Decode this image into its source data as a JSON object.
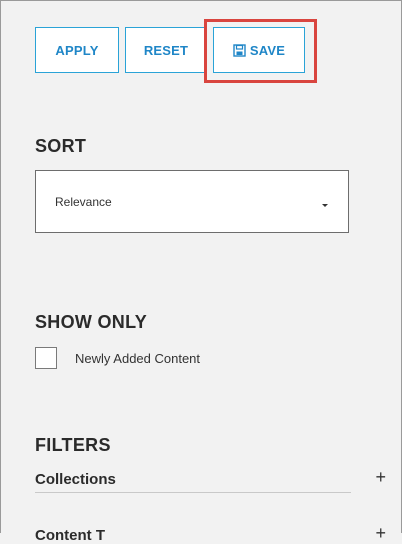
{
  "toolbar": {
    "apply_label": "APPLY",
    "reset_label": "RESET",
    "save_label": "SAVE"
  },
  "sort": {
    "title": "SORT",
    "selected": "Relevance"
  },
  "show_only": {
    "title": "SHOW ONLY",
    "newly_added_label": "Newly Added Content",
    "newly_added_checked": false
  },
  "filters": {
    "title": "FILTERS",
    "items": [
      {
        "label": "Collections",
        "toggle": "+"
      },
      {
        "label": "Content T",
        "toggle": "+"
      }
    ]
  },
  "colors": {
    "accent": "#1f86c7",
    "button_border": "#2aa3d7",
    "highlight": "#d9453f",
    "background": "#f2f2f2"
  },
  "icons": {
    "save": "save-icon",
    "dropdown": "chevron-down-icon",
    "expand": "plus-icon"
  }
}
